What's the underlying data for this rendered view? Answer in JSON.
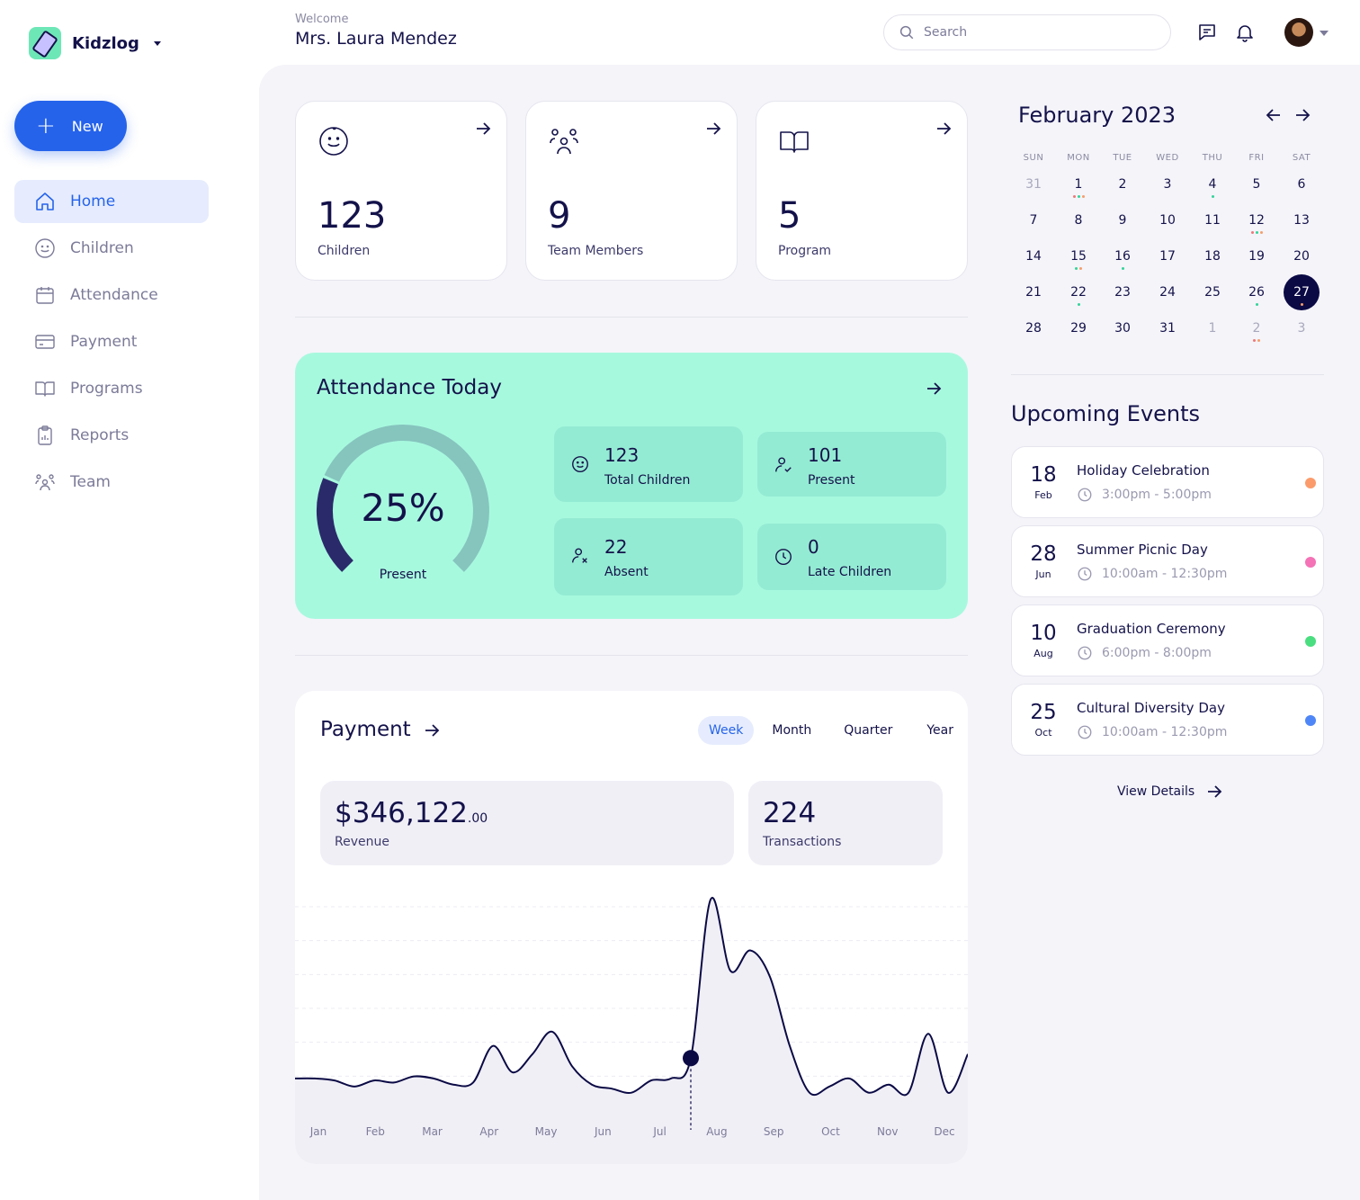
{
  "app": {
    "name": "Kidzlog"
  },
  "sidebar": {
    "new_label": "New",
    "items": [
      {
        "label": "Home",
        "icon": "home-icon"
      },
      {
        "label": "Children",
        "icon": "smile-icon"
      },
      {
        "label": "Attendance",
        "icon": "calendar-icon"
      },
      {
        "label": "Payment",
        "icon": "card-icon"
      },
      {
        "label": "Programs",
        "icon": "book-icon"
      },
      {
        "label": "Reports",
        "icon": "clipboard-icon"
      },
      {
        "label": "Team",
        "icon": "team-icon"
      }
    ]
  },
  "header": {
    "welcome": "Welcome",
    "user": "Mrs. Laura Mendez",
    "search_placeholder": "Search"
  },
  "stats": [
    {
      "value": "123",
      "label": "Children"
    },
    {
      "value": "9",
      "label": "Team Members"
    },
    {
      "value": "5",
      "label": "Program"
    }
  ],
  "attendance": {
    "title": "Attendance Today",
    "percent": "25%",
    "percent_value": 25,
    "percent_label": "Present",
    "cards": [
      {
        "value": "123",
        "label": "Total Children"
      },
      {
        "value": "101",
        "label": "Present"
      },
      {
        "value": "22",
        "label": "Absent"
      },
      {
        "value": "0",
        "label": "Late Children"
      }
    ]
  },
  "payment": {
    "title": "Payment",
    "tabs": [
      "Week",
      "Month",
      "Quarter",
      "Year"
    ],
    "active_tab": "Week",
    "revenue": {
      "whole": "$346,122",
      "cents": ".00",
      "label": "Revenue"
    },
    "transactions": {
      "value": "224",
      "label": "Transactions"
    }
  },
  "chart_data": {
    "type": "area",
    "categories": [
      "Jan",
      "Feb",
      "Mar",
      "Apr",
      "May",
      "Jun",
      "Jul",
      "Aug",
      "Sep",
      "Oct",
      "Nov",
      "Dec"
    ],
    "values": [
      12,
      12,
      11,
      8,
      11,
      10,
      13,
      12,
      9,
      10,
      28,
      15,
      24,
      35,
      18,
      9,
      7,
      5,
      11,
      12,
      22,
      100,
      65,
      75,
      62,
      28,
      5,
      8,
      12,
      5,
      9,
      5,
      34,
      5,
      24
    ],
    "highlight_index": 20,
    "grid": true,
    "line_color": "#0b0a45",
    "fill_color": "#f0eff6"
  },
  "calendar": {
    "title": "February 2023",
    "weekdays": [
      "SUN",
      "MON",
      "TUE",
      "WED",
      "THU",
      "FRI",
      "SAT"
    ],
    "weeks": [
      [
        {
          "d": "31",
          "m": true
        },
        {
          "d": "1",
          "dots": [
            "#f07777",
            "#34d399",
            "#f59e6b"
          ]
        },
        {
          "d": "2"
        },
        {
          "d": "3"
        },
        {
          "d": "4",
          "dots": [
            "#34d399"
          ]
        },
        {
          "d": "5"
        },
        {
          "d": "6"
        }
      ],
      [
        {
          "d": "7"
        },
        {
          "d": "8"
        },
        {
          "d": "9"
        },
        {
          "d": "10"
        },
        {
          "d": "11"
        },
        {
          "d": "12",
          "dots": [
            "#f07777",
            "#34d399",
            "#f59e6b"
          ]
        },
        {
          "d": "13"
        }
      ],
      [
        {
          "d": "14"
        },
        {
          "d": "15",
          "dots": [
            "#34d399",
            "#f59e6b"
          ]
        },
        {
          "d": "16",
          "dots": [
            "#34d399"
          ]
        },
        {
          "d": "17"
        },
        {
          "d": "18"
        },
        {
          "d": "19"
        },
        {
          "d": "20"
        }
      ],
      [
        {
          "d": "21"
        },
        {
          "d": "22",
          "dots": [
            "#34d399"
          ]
        },
        {
          "d": "23"
        },
        {
          "d": "24"
        },
        {
          "d": "25"
        },
        {
          "d": "26",
          "dots": [
            "#34d399"
          ]
        },
        {
          "d": "27",
          "sel": true,
          "dots": [
            "#f59e6b"
          ]
        }
      ],
      [
        {
          "d": "28"
        },
        {
          "d": "29"
        },
        {
          "d": "30"
        },
        {
          "d": "31"
        },
        {
          "d": "1",
          "m": true
        },
        {
          "d": "2",
          "m": true,
          "dots": [
            "#f07777",
            "#f59e6b"
          ]
        },
        {
          "d": "3",
          "m": true
        }
      ]
    ]
  },
  "events": {
    "title": "Upcoming Events",
    "items": [
      {
        "day": "18",
        "month": "Feb",
        "name": "Holiday Celebration",
        "time": "3:00pm - 5:00pm",
        "color": "#fb9b6b"
      },
      {
        "day": "28",
        "month": "Jun",
        "name": "Summer Picnic Day",
        "time": "10:00am - 12:30pm",
        "color": "#f472b6"
      },
      {
        "day": "10",
        "month": "Aug",
        "name": "Graduation Ceremony",
        "time": "6:00pm - 8:00pm",
        "color": "#4ade80"
      },
      {
        "day": "25",
        "month": "Oct",
        "name": "Cultural Diversity Day",
        "time": "10:00am - 12:30pm",
        "color": "#4f86f7"
      }
    ],
    "view_details": "View Details"
  }
}
